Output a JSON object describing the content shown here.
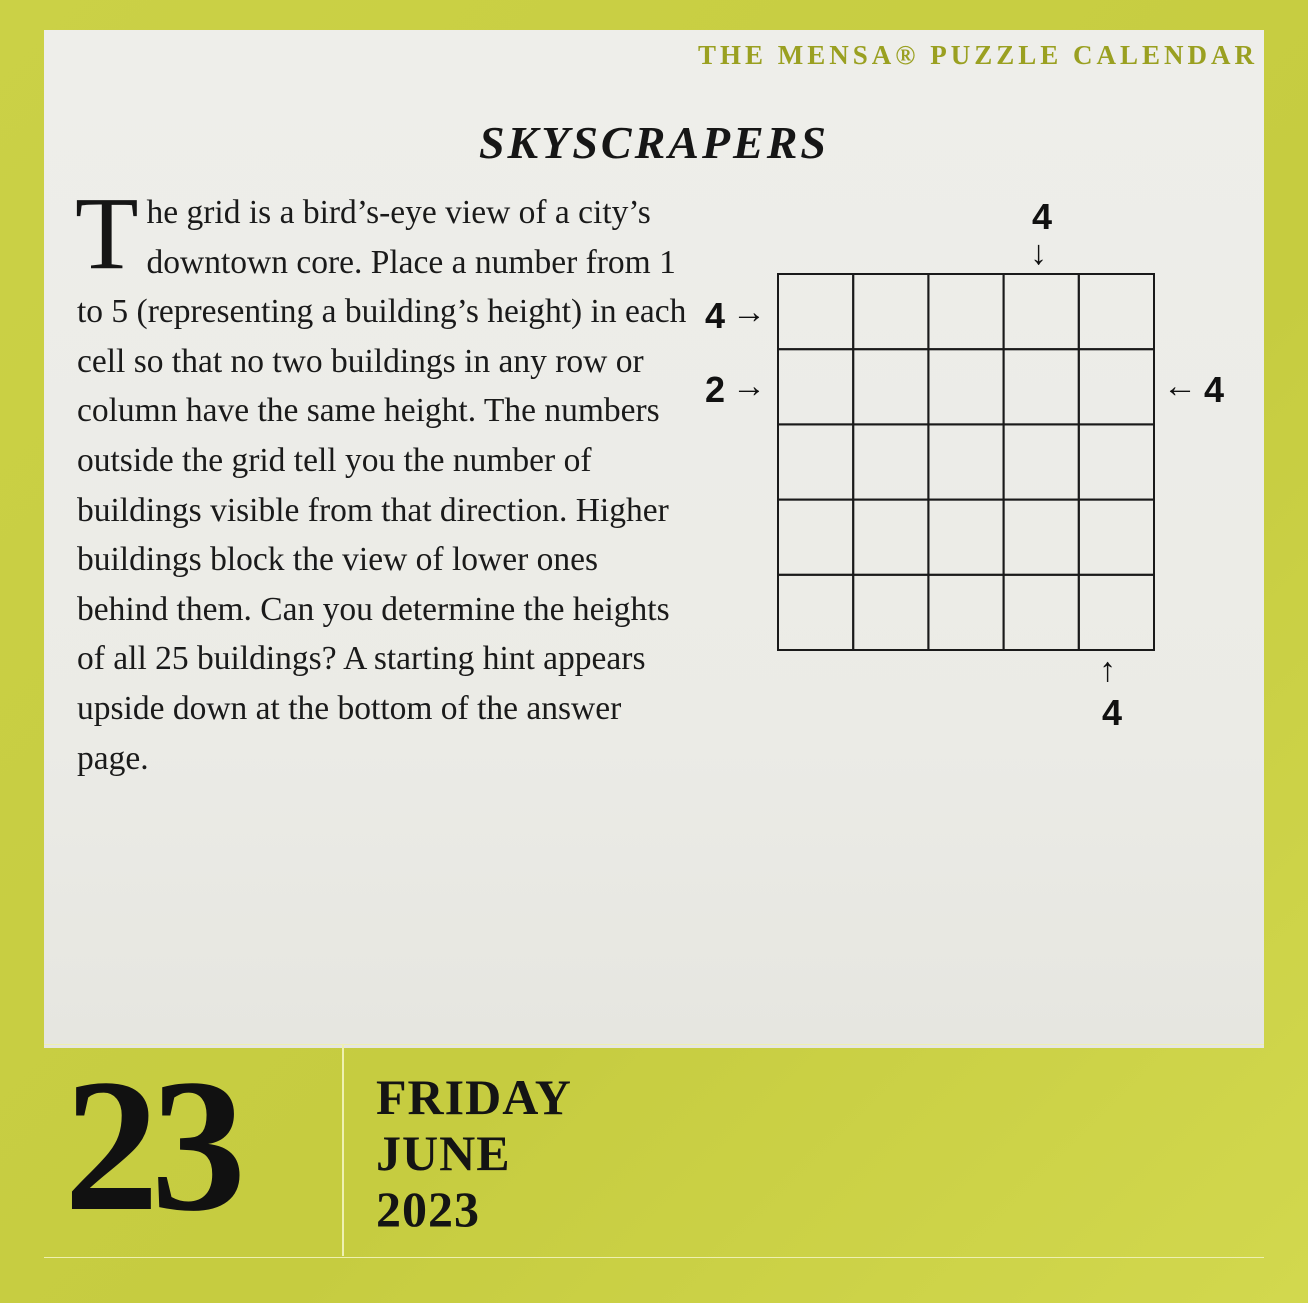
{
  "brand": "THE MENSA® PUZZLE CALENDAR",
  "puzzle": {
    "title": "SKYSCRAPERS",
    "drop_cap": "T",
    "instructions_rest": "he grid is a bird’s-eye view of a city’s downtown core. Place a number from 1 to 5 (representing a building’s height) in each cell so that no two buildings in any row or column have the same height. The numbers outside the grid tell you the number of buildings visible from that direction. Higher buildings block the view of lower ones behind them. Can you determine the heights of all 25 buildings? A starting hint appears upside down at the bottom of the answer page.",
    "grid": {
      "rows": 5,
      "cols": 5
    },
    "clues": {
      "top_col4": "4",
      "left_row1": "4",
      "left_row2": "2",
      "right_row2": "4",
      "bottom_col5": "4"
    },
    "arrows": {
      "down": "↓",
      "right": "→",
      "left": "←",
      "up": "↑"
    }
  },
  "date": {
    "day": "23",
    "weekday": "FRIDAY",
    "month": "JUNE",
    "year": "2023"
  },
  "colors": {
    "frame": "#c9cf45",
    "page": "#ecece8",
    "brand_text": "#9aa021"
  }
}
